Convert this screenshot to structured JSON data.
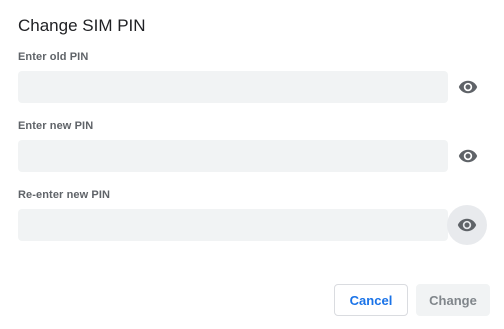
{
  "dialog": {
    "title": "Change SIM PIN"
  },
  "fields": [
    {
      "label": "Enter old PIN",
      "value": "",
      "icon": "eye-icon"
    },
    {
      "label": "Enter new PIN",
      "value": "",
      "icon": "eye-icon"
    },
    {
      "label": "Re-enter new PIN",
      "value": "",
      "icon": "eye-icon"
    }
  ],
  "buttons": {
    "cancel_label": "Cancel",
    "change_label": "Change"
  },
  "colors": {
    "accent": "#1a73e8",
    "input_bg": "#f1f3f4",
    "icon": "#5f6368",
    "disabled_text": "#80868b"
  }
}
